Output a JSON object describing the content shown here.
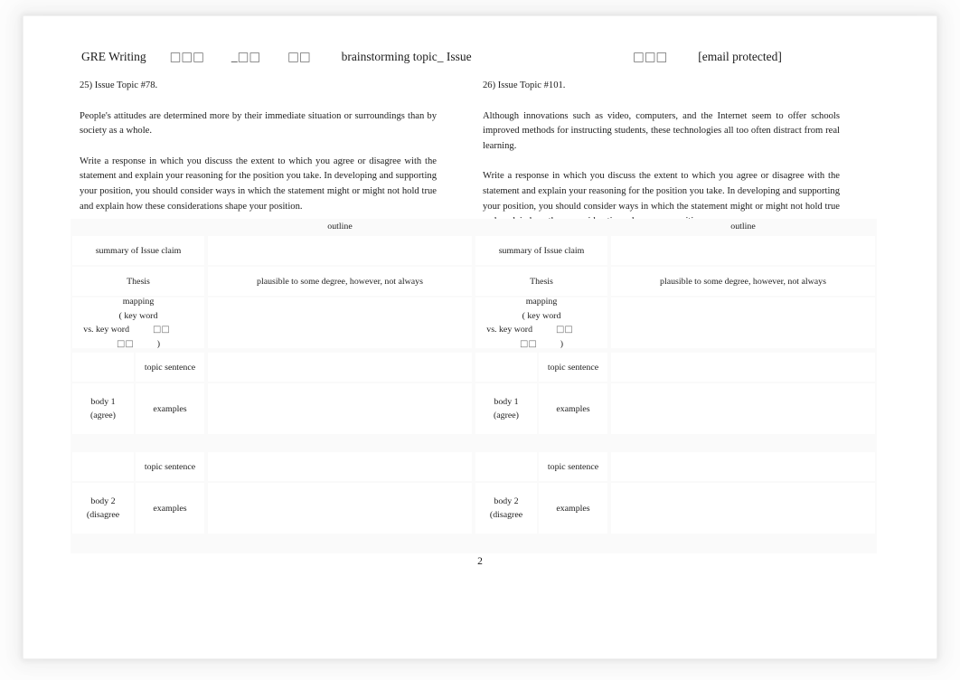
{
  "document": {
    "page_number": "2",
    "header": {
      "left_title": "GRE Writing",
      "left_tofu_1": "□□□",
      "left_underscore": "_",
      "left_tofu_2": "□□",
      "left_tofu_3": "□□",
      "left_title_2": "brainstorming topic_ Issue",
      "right_tofu": "□□□",
      "right_email": "[email protected]"
    },
    "columns": [
      {
        "topic_id": "25) Issue Topic #78.",
        "statement": "People's attitudes are determined more by their immediate situation or surroundings than by society as a whole.",
        "prompt": "Write a response in which you discuss the extent to which you agree or disagree with the statement and explain your reasoning for the position you take. In developing and supporting your position, you should consider ways in which the statement might or might not hold true and explain how these considerations shape your position."
      },
      {
        "topic_id": "26) Issue Topic #101.",
        "statement": "Although innovations such as video, computers, and the Internet seem to offer schools improved methods for instructing students, these technologies all too often distract from real learning.",
        "prompt": "Write a response in which you discuss the extent to which you agree or disagree with the statement and explain your reasoning for the position you take. In developing and supporting your position, you should consider ways in which the statement might or might not hold true and explain how these considerations shape your position."
      }
    ],
    "outline_table": {
      "title": "outline",
      "labels": {
        "summary": "summary of Issue claim",
        "thesis": "Thesis",
        "mapping_line1": "mapping",
        "mapping_line2": "( key word",
        "mapping_line3_text": "vs. key word",
        "mapping_line3_tofu_a": "□□",
        "mapping_line3_tofu_b": "□□",
        "mapping_line3_close": ")",
        "body1_line1": "body 1",
        "body1_line2": "(agree)",
        "body2_line1": "body 2",
        "body2_line2": "(disagree",
        "topic_sentence": "topic sentence",
        "examples": "examples"
      },
      "content": {
        "thesis_note": "plausible to some degree, however, not always",
        "summary_note": "",
        "mapping_note": "",
        "body1_topic_note": "",
        "body1_examples_note": "",
        "body2_topic_note": "",
        "body2_examples_note": ""
      }
    }
  }
}
